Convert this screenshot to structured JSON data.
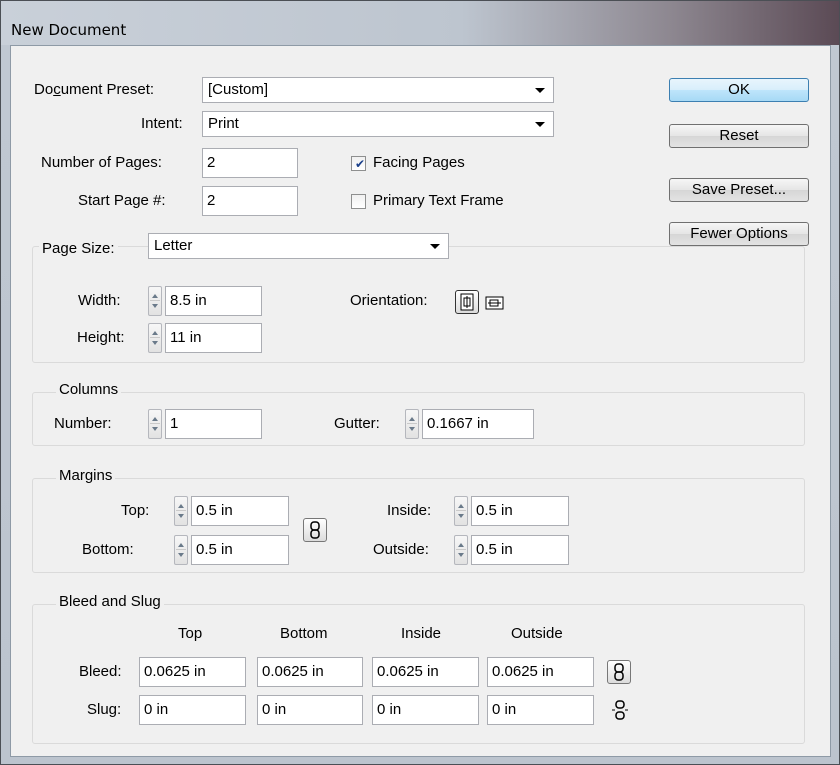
{
  "window": {
    "title": "New Document"
  },
  "preset": {
    "label": "Document Preset:",
    "mnemonic": "c",
    "value": "[Custom]"
  },
  "intent": {
    "label": "Intent:",
    "value": "Print"
  },
  "num_pages": {
    "label": "Number of Pages:",
    "value": "2"
  },
  "start_page": {
    "label": "Start Page #:",
    "value": "2"
  },
  "facing_pages": {
    "label": "Facing Pages",
    "checked": true
  },
  "primary_text_frame": {
    "label": "Primary Text Frame",
    "checked": false
  },
  "page_size": {
    "label": "Page Size:",
    "value": "Letter",
    "width_label": "Width:",
    "width_value": "8.5 in",
    "height_label": "Height:",
    "height_value": "11 in",
    "orientation_label": "Orientation:"
  },
  "columns": {
    "title": "Columns",
    "number_label": "Number:",
    "number_value": "1",
    "gutter_label": "Gutter:",
    "gutter_value": "0.1667 in"
  },
  "margins": {
    "title": "Margins",
    "top_label": "Top:",
    "top_value": "0.5 in",
    "bottom_label": "Bottom:",
    "bottom_value": "0.5 in",
    "inside_label": "Inside:",
    "inside_value": "0.5 in",
    "outside_label": "Outside:",
    "outside_value": "0.5 in"
  },
  "bleed_slug": {
    "title": "Bleed and Slug",
    "headers": [
      "Top",
      "Bottom",
      "Inside",
      "Outside"
    ],
    "bleed_label": "Bleed:",
    "bleed_values": [
      "0.0625 in",
      "0.0625 in",
      "0.0625 in",
      "0.0625 in"
    ],
    "slug_label": "Slug:",
    "slug_values": [
      "0 in",
      "0 in",
      "0 in",
      "0 in"
    ]
  },
  "buttons": {
    "ok": "OK",
    "reset": "Reset",
    "save_preset": "Save Preset...",
    "fewer_options": "Fewer Options"
  }
}
